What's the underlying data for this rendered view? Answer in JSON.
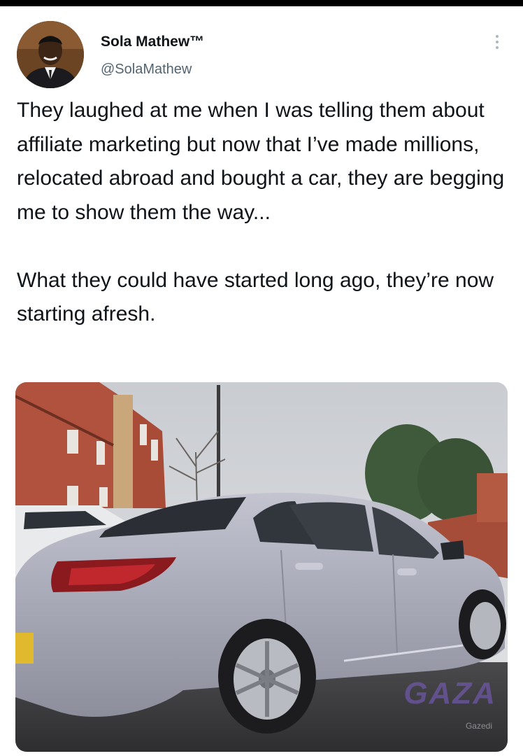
{
  "author": {
    "display_name": "Sola Mathew™",
    "handle": "@SolaMathew",
    "avatar_icon": "profile-photo"
  },
  "menu": {
    "icon": "more-vertical-icon"
  },
  "tweet": {
    "paragraphs": [
      "They laughed at me when I was telling them about affiliate marketing but now that I’ve made millions, relocated abroad and bought a car, they are begging me to show them the way...",
      "What they could have started long ago, they’re now starting afresh."
    ]
  },
  "media": {
    "watermark": "GAZA",
    "watermark_sub": "Gazedi"
  },
  "colors": {
    "text": "#0f1419",
    "secondary_text": "#536471",
    "car_body": "#a9aab8",
    "brick": "#b5533e"
  }
}
